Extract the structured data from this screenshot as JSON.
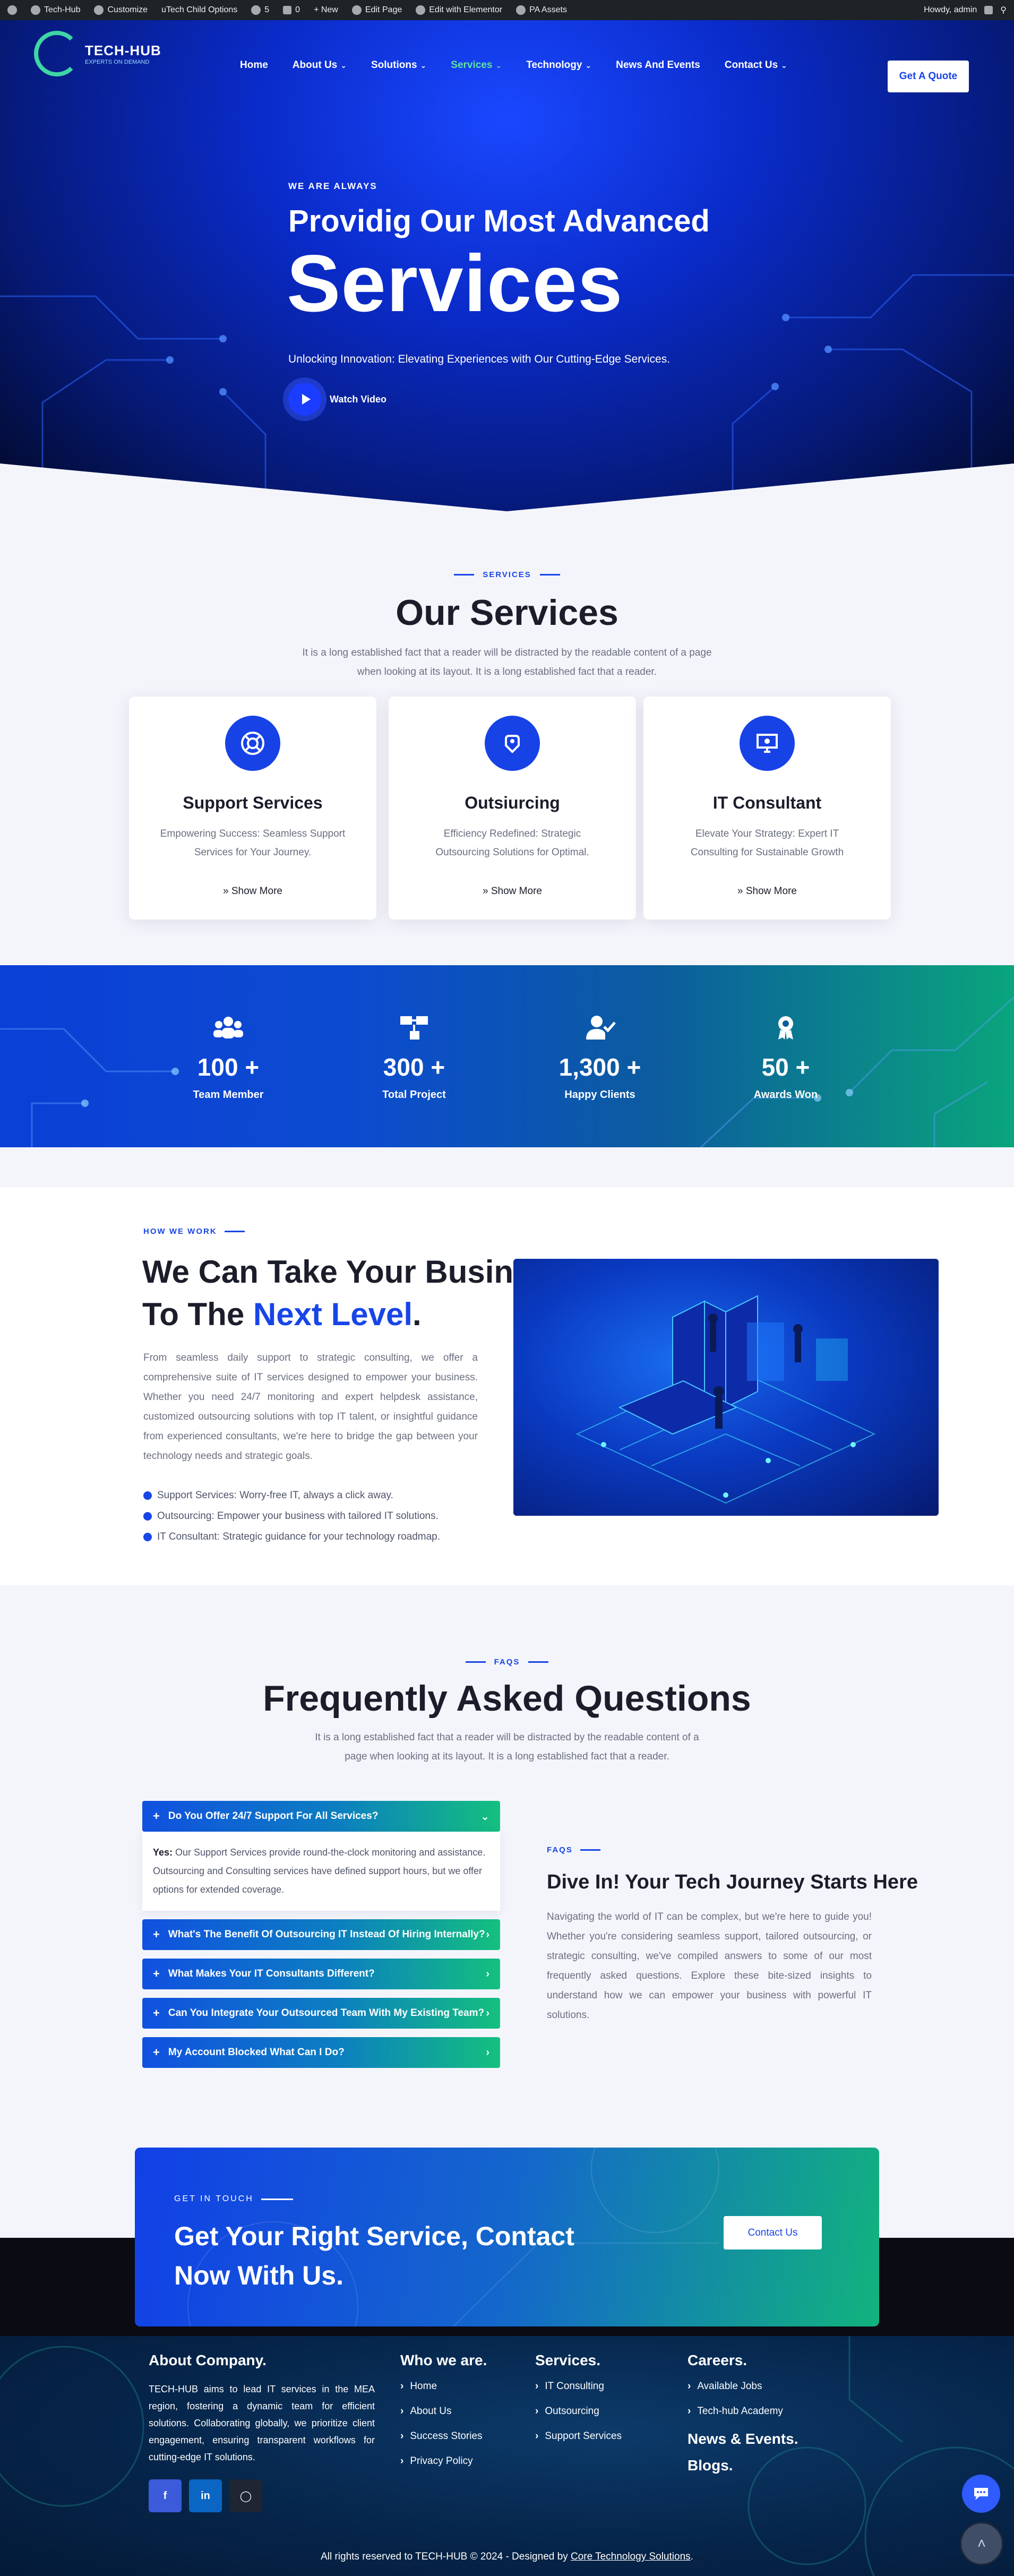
{
  "adminbar": {
    "items": [
      "Tech-Hub",
      "Customize",
      "uTech Child Options",
      "5",
      "0",
      "+ New",
      "Edit Page",
      "Edit with Elementor",
      "PA Assets"
    ],
    "howdy": "Howdy, admin"
  },
  "header": {
    "logo_text": "TECH-HUB",
    "logo_tagline": "EXPERTS ON DEMAND",
    "nav": [
      "Home",
      "About Us",
      "Solutions",
      "Services",
      "Technology",
      "News And Events",
      "Contact Us"
    ],
    "active_nav": "Services",
    "quote_button": "Get A Quote"
  },
  "hero": {
    "kicker": "WE ARE ALWAYS",
    "subtitle": "Providig Our Most Advanced",
    "title": "Services",
    "description": "Unlocking Innovation: Elevating Experiences with Our Cutting-Edge Services.",
    "watch_video": "Watch Video"
  },
  "services": {
    "kicker": "SERVICES",
    "title": "Our Services",
    "desc_line1": "It is a long established fact that a reader will be distracted by the readable content of a page",
    "desc_line2": "when looking at its layout. It is a long established fact that a reader.",
    "cards": [
      {
        "title": "Support Services",
        "desc_line1": "Empowering Success: Seamless Support",
        "desc_line2": "Services for Your Journey.",
        "more": "Show More",
        "icon": "lifebuoy-icon"
      },
      {
        "title": "Outsiurcing",
        "desc_line1": "Efficiency Redefined: Strategic",
        "desc_line2": "Outsourcing Solutions for Optimal.",
        "more": "Show More",
        "icon": "outsourcing-icon"
      },
      {
        "title": "IT Consultant",
        "desc_line1": "Elevate Your Strategy: Expert IT",
        "desc_line2": "Consulting for Sustainable Growth",
        "more": "Show More",
        "icon": "consultant-monitor-icon"
      }
    ]
  },
  "stats": [
    {
      "value": "100 +",
      "label": "Team Member",
      "icon": "team-icon"
    },
    {
      "value": "300 +",
      "label": "Total Project",
      "icon": "project-icon"
    },
    {
      "value": "1,300 +",
      "label": "Happy Clients",
      "icon": "client-icon"
    },
    {
      "value": "50 +",
      "label": "Awards Won",
      "icon": "award-icon"
    }
  ],
  "how": {
    "kicker": "HOW WE WORK",
    "title_line1": "We Can Take Your Business",
    "title_line2_prefix": "To The ",
    "title_accent": "Next Level",
    "title_suffix": ".",
    "description": "From seamless daily support to strategic consulting, we offer a comprehensive suite of IT services designed to empower your business. Whether you need 24/7 monitoring and expert helpdesk assistance, customized outsourcing solutions with top IT talent, or insightful guidance from experienced consultants, we're here to bridge the gap between your technology needs and strategic goals.",
    "bullets": [
      "Support Services: Worry-free IT, always a click away.",
      "Outsourcing: Empower your business with tailored IT solutions.",
      "IT Consultant: Strategic guidance for your technology roadmap."
    ]
  },
  "faq": {
    "kicker": "FAQS",
    "title": "Frequently Asked Questions",
    "desc_line1": "It is a long established fact that a reader will be distracted by the readable content of a",
    "desc_line2": "page when looking at its layout. It is a long established fact that a reader.",
    "items": [
      {
        "q": "Do You Offer 24/7 Support For All Services?",
        "open": true
      },
      {
        "q": "What's The Benefit Of Outsourcing IT Instead Of Hiring Internally?",
        "open": false
      },
      {
        "q": "What Makes Your IT Consultants Different?",
        "open": false
      },
      {
        "q": "Can You Integrate Your Outsourced Team With My Existing Team?",
        "open": false
      },
      {
        "q": "My Account Blocked What Can I Do?",
        "open": false
      }
    ],
    "answer_label": "Yes:",
    "answer": " Our Support Services provide round-the-clock monitoring and assistance. Outsourcing and Consulting services have defined support hours, but we offer options for extended coverage.",
    "side_kicker": "FAQS",
    "side_title": "Dive In! Your Tech Journey Starts Here",
    "side_desc": "Navigating the world of IT can be complex, but we're here to guide you! Whether you're considering seamless support, tailored outsourcing, or strategic consulting, we've compiled answers to some of our most frequently asked questions. Explore these bite-sized insights to understand how we can empower your business with powerful IT solutions."
  },
  "cta": {
    "kicker": "GET IN TOUCH",
    "title_line1": "Get Your Right Service, Contact",
    "title_line2": "Now With Us.",
    "button": "Contact Us"
  },
  "footer": {
    "about_title": "About Company.",
    "about_text": "TECH-HUB aims to lead IT services in the MEA region, fostering a dynamic team for efficient solutions. Collaborating globally, we prioritize client engagement, ensuring transparent workflows for cutting-edge IT solutions.",
    "who_title": "Who we are.",
    "who_links": [
      "Home",
      "About Us",
      "Success Stories",
      "Privacy Policy"
    ],
    "services_title": "Services.",
    "services_links": [
      "IT Consulting",
      "Outsourcing",
      "Support Services"
    ],
    "careers_title": "Careers.",
    "careers_links": [
      "Available Jobs",
      "Tech-hub Academy"
    ],
    "news_title": "News & Events.",
    "blogs_title": "Blogs.",
    "copyright": "All rights reserved to TECH-HUB © 2024 - Designed by ",
    "designer": "Core Technology Solutions",
    "copyright_end": "."
  },
  "colors": {
    "accent": "#1845e8",
    "green": "#14c07e",
    "dark": "#0b0b14"
  }
}
